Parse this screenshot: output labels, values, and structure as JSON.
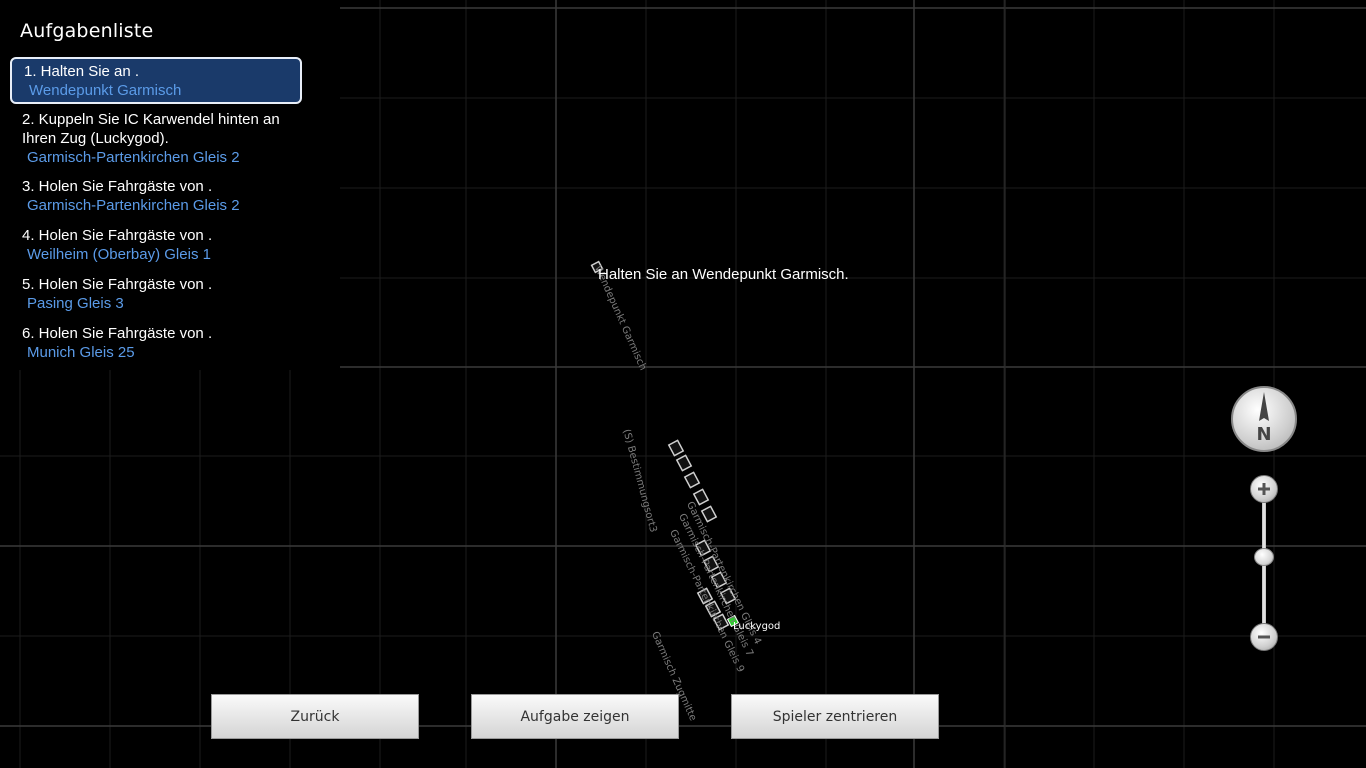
{
  "task_list": {
    "title": "Aufgabenliste",
    "tasks": [
      {
        "text": "1. Halten Sie an  .",
        "location": "Wendepunkt Garmisch"
      },
      {
        "text": "2. Kuppeln Sie IC Karwendel hinten an Ihren Zug (Luckygod).",
        "location": "Garmisch-Partenkirchen Gleis 2"
      },
      {
        "text": "3. Holen Sie Fahrgäste von  .",
        "location": "Garmisch-Partenkirchen Gleis 2"
      },
      {
        "text": "4. Holen Sie Fahrgäste von  .",
        "location": "Weilheim (Oberbay) Gleis 1"
      },
      {
        "text": "5. Holen Sie Fahrgäste von  .",
        "location": "Pasing Gleis 3"
      },
      {
        "text": "6. Holen Sie Fahrgäste von  .",
        "location": "Munich Gleis 25"
      }
    ]
  },
  "map": {
    "caption": "Halten Sie an  Wendepunkt Garmisch.",
    "player_name": "Luckygod",
    "labels": {
      "wendepunkt": "Wendepunkt Garmisch",
      "bestimmungsort": "(S) Bestimmungsort3",
      "zugmitte": "Garmisch Zugmitte",
      "gleis_a": "Garmisch-Partenkirchen Gleis 4",
      "gleis_b": "Garmisch-Partenkirchen Gleis 7",
      "gleis_c": "Garmisch-Partenkirchen Gleis 9"
    },
    "compass_letter": "N",
    "player_color": "#2ecc2e"
  },
  "buttons": {
    "back": "Zurück",
    "show_task": "Aufgabe zeigen",
    "center_player": "Spieler zentrieren"
  },
  "icons": {
    "compass": "compass-north-icon",
    "zoom_in": "plus-icon",
    "zoom_out": "minus-icon"
  }
}
